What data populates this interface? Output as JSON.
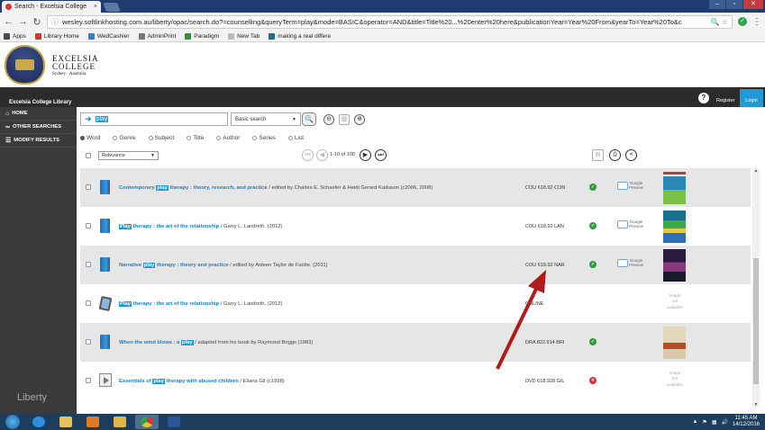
{
  "browser": {
    "tab_title": "Search - Excelsia College",
    "tab_close": "×",
    "url": "wesley.softlinkhosting.com.au/liberty/opac/search.do?=counselling&queryTerm=play&mode=BASIC&operator=AND&title=Title%20...%20enter%20here&publicationYear=Year%20From&yearTo=Year%20To&c",
    "bookmarks": [
      {
        "label": "Apps",
        "color": "#4a4a4a"
      },
      {
        "label": "Library Home",
        "color": "#d33"
      },
      {
        "label": "WedCashier",
        "color": "#3a7bd5"
      },
      {
        "label": "AdminPrint",
        "color": "#777"
      },
      {
        "label": "Paradigm",
        "color": "#3a8d3a"
      },
      {
        "label": "New Tab",
        "color": "#bbb"
      },
      {
        "label": "making a real differe",
        "color": "#1a6e8e"
      }
    ]
  },
  "site": {
    "college_line1": "EXCELSIA",
    "college_line2": "COLLEGE",
    "college_line3": "Sydney · Australia",
    "library_name": "Excelsia College Library",
    "help": "?",
    "register": "Register",
    "login": "Login",
    "footer_logo": "Liberty"
  },
  "sidebar": {
    "items": [
      {
        "label": "HOME",
        "icon": "home-icon"
      },
      {
        "label": "OTHER SEARCHES",
        "icon": "binoculars-icon"
      },
      {
        "label": "MODIFY RESULTS",
        "icon": "list-icon"
      }
    ]
  },
  "search": {
    "query": "play",
    "type": "Basic search",
    "scopes": [
      "Word",
      "Genre",
      "Subject",
      "Title",
      "Author",
      "Series",
      "List"
    ],
    "selected_scope": "Word"
  },
  "toolbar": {
    "sort": "Relevance",
    "page_info": "1-10 of 100"
  },
  "results": [
    {
      "pre": "Contemporary ",
      "hl": "play",
      "post": " therapy : theory, research, and practice",
      "author": " / edited by Charles E. Schaefer & Heidi Gerard Kaduson  (c2006, 2008)",
      "call": "COU 618.92 CON",
      "status": "available",
      "google": true,
      "cover": "cover1",
      "shade": true,
      "kind": "book"
    },
    {
      "pre": "",
      "hl": "Play",
      "post": " therapy : the art of the relationship",
      "author": " / Garry L. Landreth.  (2012)",
      "call": "COU 618.92 LAN",
      "status": "available",
      "google": true,
      "cover": "cover2",
      "shade": false,
      "kind": "book"
    },
    {
      "pre": "Narrative ",
      "hl": "play",
      "post": " therapy : theory and practice",
      "author": " / edited by Aideen Taylor de Faoite.  (2011)",
      "call": "COU 618.92 NAR",
      "status": "available",
      "google": true,
      "cover": "cover3",
      "shade": true,
      "kind": "book"
    },
    {
      "pre": "",
      "hl": "Play",
      "post": " therapy : the art of the relationship",
      "author": " / Garry L. Landreth.  (2012)",
      "call": "ONLINE",
      "status": "none",
      "google": false,
      "cover": "none",
      "shade": false,
      "kind": "ebook"
    },
    {
      "pre": "When the wind blows : a ",
      "hl": "play",
      "post": "",
      "author": " / adapted from his book by Raymond Briggs  (1983)",
      "call": "DRA 822.914 BRI",
      "status": "available",
      "google": false,
      "cover": "cover4",
      "shade": true,
      "kind": "book"
    },
    {
      "pre": "Essentials of ",
      "hl": "play",
      "post": " therapy with abused children",
      "author": " / Eliana Gil  (c1998)",
      "call": "DVD 618.928 GIL",
      "status": "unavailable",
      "google": false,
      "cover": "none",
      "shade": false,
      "kind": "video"
    }
  ],
  "google_preview": {
    "line1": "Google",
    "line2": "Preview"
  },
  "no_image": {
    "line1": "Image",
    "line2": "not",
    "line3": "available"
  },
  "taskbar": {
    "time": "11:45 AM",
    "date": "14/12/2016"
  },
  "colors": {
    "accent": "#1f9ad6",
    "annotation_arrow": "#b01c1c"
  }
}
